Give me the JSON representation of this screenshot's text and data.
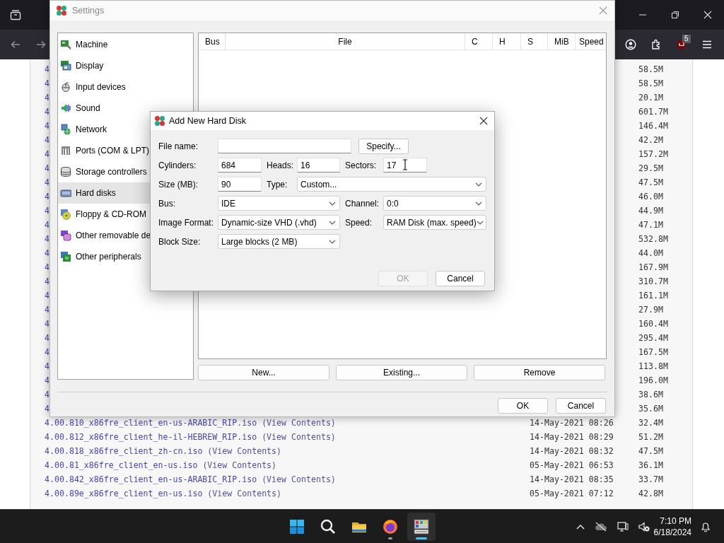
{
  "browser": {
    "badge": "5",
    "rows": [
      {
        "name": "4",
        "size": "58.5M"
      },
      {
        "name": "4",
        "size": "58.5M"
      },
      {
        "name": "4",
        "size": "20.1M"
      },
      {
        "name": "4",
        "size": "601.7M"
      },
      {
        "name": "4",
        "size": "146.4M"
      },
      {
        "name": "4",
        "size": "42.2M"
      },
      {
        "name": "4",
        "size": "157.2M"
      },
      {
        "name": "4",
        "size": "29.5M"
      },
      {
        "name": "4",
        "size": "47.5M"
      },
      {
        "name": "4",
        "size": "46.0M"
      },
      {
        "name": "4",
        "size": "44.9M"
      },
      {
        "name": "4",
        "size": "47.1M"
      },
      {
        "name": "4",
        "size": "532.8M"
      },
      {
        "name": "4",
        "size": "44.0M"
      },
      {
        "name": "4",
        "size": "167.9M"
      },
      {
        "name": "4",
        "size": "310.7M"
      },
      {
        "name": "4",
        "size": "161.1M"
      },
      {
        "name": "4",
        "size": "27.9M"
      },
      {
        "name": "4",
        "size": "160.4M"
      },
      {
        "name": "4",
        "size": "295.4M"
      },
      {
        "name": "4",
        "size": "167.5M"
      },
      {
        "name": "4",
        "size": "113.8M"
      },
      {
        "name": "4",
        "size": "196.0M"
      },
      {
        "name": "4",
        "size": "38.6M"
      },
      {
        "name": "4",
        "size": "35.6M"
      },
      {
        "name": "4.00.810_x86fre_client_en-us-ARABIC_RIP.iso",
        "view": "(View Contents)",
        "date": "14-May-2021 08:26",
        "size": "32.4M"
      },
      {
        "name": "4.00.812_x86fre_client_he-il-HEBREW_RIP.iso",
        "view": "(View Contents)",
        "date": "14-May-2021 08:29",
        "size": "51.2M"
      },
      {
        "name": "4.00.818_x86fre_client_zh-cn.iso",
        "view": "(View Contents)",
        "date": "14-May-2021 08:32",
        "size": "47.5M"
      },
      {
        "name": "4.00.81_x86fre_client_en-us.iso",
        "view": "(View Contents)",
        "date": "05-May-2021 06:53",
        "size": "36.1M"
      },
      {
        "name": "4.00.842_x86fre_client_en-us-ARABIC_RIP.iso",
        "view": "(View Contents)",
        "date": "14-May-2021 08:35",
        "size": "33.7M"
      },
      {
        "name": "4.00.89e_x86fre_client_en-us.iso",
        "view": "(View Contents)",
        "date": "05-May-2021 07:12",
        "size": "42.8M"
      }
    ]
  },
  "settings": {
    "title": "Settings",
    "sidebar": [
      {
        "label": "Machine",
        "selected": false
      },
      {
        "label": "Display",
        "selected": false
      },
      {
        "label": "Input devices",
        "selected": false
      },
      {
        "label": "Sound",
        "selected": false
      },
      {
        "label": "Network",
        "selected": false
      },
      {
        "label": "Ports (COM & LPT)",
        "selected": false
      },
      {
        "label": "Storage controllers",
        "selected": false
      },
      {
        "label": "Hard disks",
        "selected": true
      },
      {
        "label": "Floppy & CD-ROM",
        "selected": false
      },
      {
        "label": "Other removable de",
        "selected": false
      },
      {
        "label": "Other peripherals",
        "selected": false
      }
    ],
    "columns": [
      "Bus",
      "File",
      "C",
      "H",
      "S",
      "MiB",
      "Speed"
    ],
    "buttons": [
      "New...",
      "Existing...",
      "Remove"
    ],
    "footer_buttons": [
      "OK",
      "Cancel"
    ]
  },
  "dialog": {
    "title": "Add New Hard Disk",
    "file_name": {
      "label": "File name:"
    },
    "specify_button": "Specify...",
    "cylinders": {
      "label": "Cylinders:",
      "value": "684"
    },
    "heads": {
      "label": "Heads:",
      "value": "16"
    },
    "sectors": {
      "label": "Sectors:",
      "value": "17"
    },
    "size": {
      "label": "Size (MB):",
      "value": "90"
    },
    "type": {
      "label": "Type:",
      "value": "Custom..."
    },
    "bus": {
      "label": "Bus:",
      "value": "IDE"
    },
    "channel": {
      "label": "Channel:",
      "value": "0:0"
    },
    "image_format": {
      "label": "Image Format:",
      "value": "Dynamic-size VHD (.vhd)"
    },
    "speed": {
      "label": "Speed:",
      "value": "RAM Disk (max. speed)"
    },
    "block_size": {
      "label": "Block Size:",
      "value": "Large blocks (2 MB)"
    },
    "buttons": [
      {
        "label": "OK",
        "disabled": true
      },
      {
        "label": "Cancel",
        "disabled": false
      }
    ]
  },
  "taskbar": {
    "apps": [
      {
        "open": false,
        "selected": false
      },
      {
        "open": true,
        "selected": false
      },
      {
        "open": true,
        "selected": true
      }
    ],
    "time": "7:10 PM",
    "date": "6/18/2024"
  }
}
